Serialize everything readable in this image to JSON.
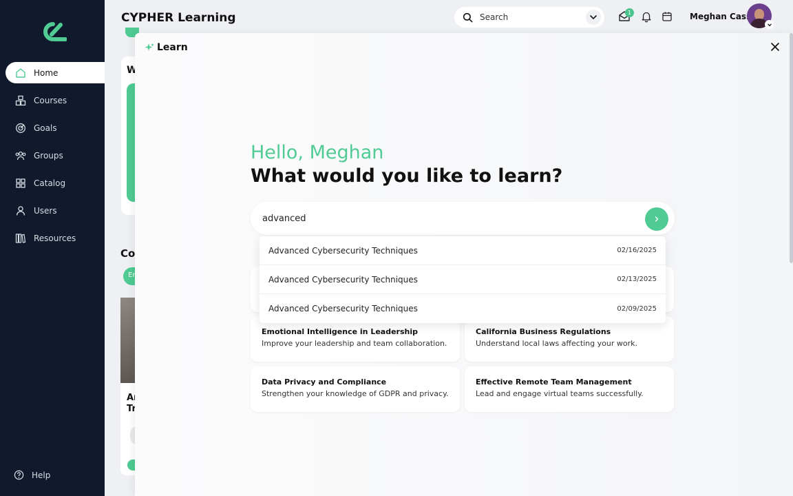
{
  "app": {
    "title": "CYPHER Learning"
  },
  "sidebar": {
    "items": [
      {
        "label": "Home",
        "icon": "home-icon",
        "active": true
      },
      {
        "label": "Courses",
        "icon": "courses-icon"
      },
      {
        "label": "Goals",
        "icon": "goals-icon"
      },
      {
        "label": "Groups",
        "icon": "groups-icon"
      },
      {
        "label": "Catalog",
        "icon": "catalog-icon"
      },
      {
        "label": "Users",
        "icon": "user-icon"
      },
      {
        "label": "Resources",
        "icon": "resources-icon"
      }
    ],
    "help_label": "Help"
  },
  "header": {
    "search_placeholder": "Search",
    "inbox_badge": "1",
    "user_name": "Meghan Cass"
  },
  "background": {
    "w_fragment": "W",
    "co_fragment": "Co",
    "en_fragment": "En",
    "ar_fragment": "Ar",
    "tr_fragment": "Tr"
  },
  "learn": {
    "panel_title": "Learn",
    "greeting": "Hello, Meghan",
    "question": "What would you like to learn?",
    "input_value": "advanced",
    "dropdown": [
      {
        "name": "Advanced Cybersecurity Techniques",
        "date": "02/16/2025"
      },
      {
        "name": "Advanced Cybersecurity Techniques",
        "date": "02/13/2025"
      },
      {
        "name": "Advanced Cybersecurity Techniques",
        "date": "02/09/2025"
      }
    ],
    "suggestions": [
      {
        "title": "Emotional Intelligence in Leadership",
        "desc": "Improve your leadership and team collaboration."
      },
      {
        "title": "California Business Regulations",
        "desc": "Understand local laws affecting your work."
      },
      {
        "title": "Data Privacy and Compliance",
        "desc": "Strengthen your knowledge of GDPR and privacy."
      },
      {
        "title": "Effective Remote Team Management",
        "desc": "Lead and engage virtual teams successfully."
      }
    ]
  },
  "colors": {
    "accent": "#4fcb93",
    "sidebar_bg": "#111a2c"
  }
}
